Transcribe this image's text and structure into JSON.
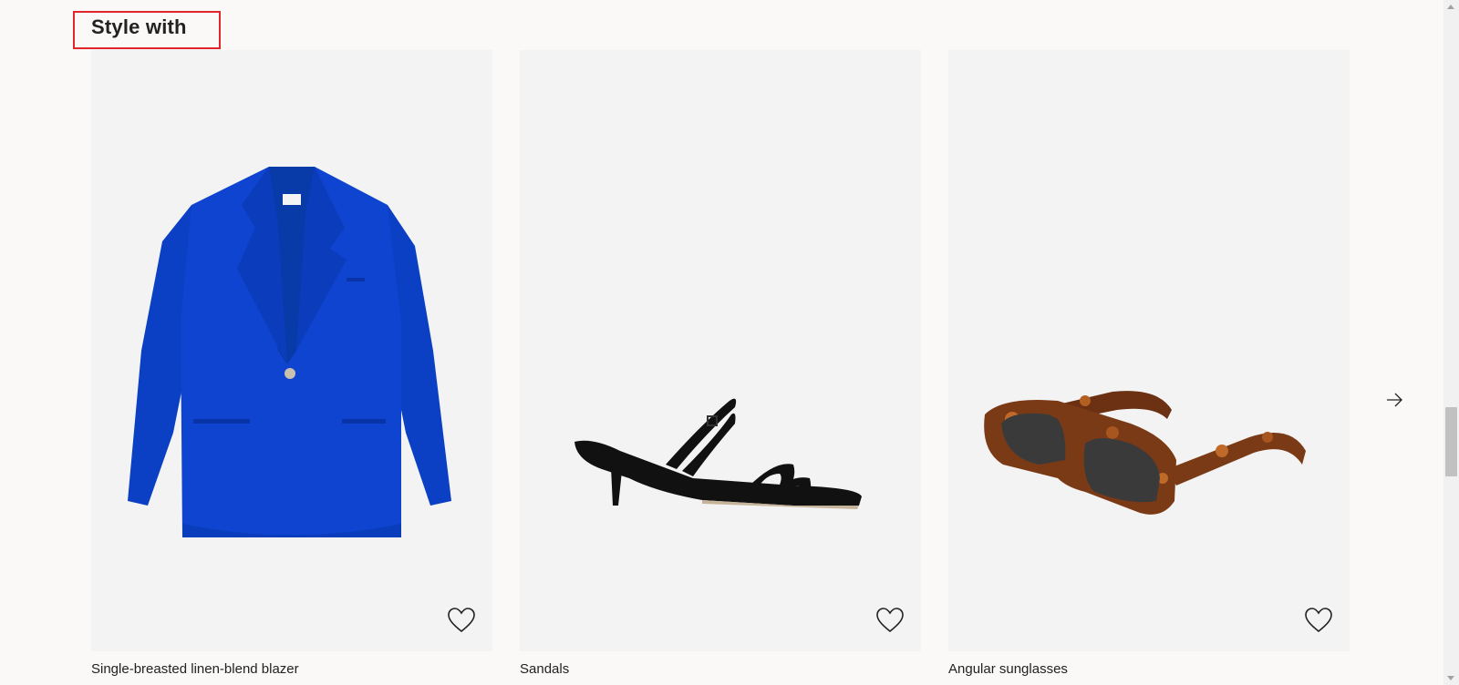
{
  "section": {
    "title": "Style with"
  },
  "products": [
    {
      "name": "Single-breasted linen-blend blazer",
      "image_icon": "blazer-image",
      "favorite_icon": "heart-outline-icon",
      "color": "#0a3dc0"
    },
    {
      "name": "Sandals",
      "image_icon": "sandal-image",
      "favorite_icon": "heart-outline-icon",
      "color": "#111111"
    },
    {
      "name": "Angular sunglasses",
      "image_icon": "sunglasses-image",
      "favorite_icon": "heart-outline-icon",
      "color": "#7a3a15"
    }
  ],
  "carousel": {
    "next_icon": "arrow-right-icon"
  },
  "colors": {
    "highlight_border": "#e0252c",
    "card_background": "#f3f3f3",
    "page_background": "#faf9f8"
  }
}
